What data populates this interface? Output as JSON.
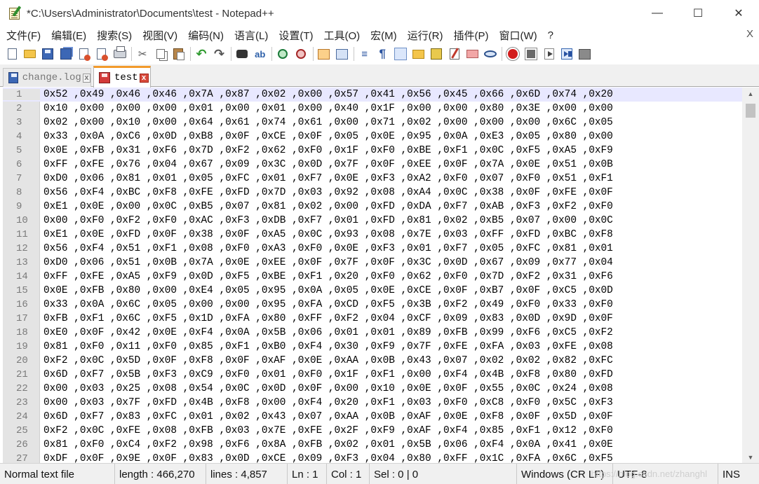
{
  "window": {
    "title": "*C:\\Users\\Administrator\\Documents\\test - Notepad++",
    "minimize": "—",
    "maximize": "☐",
    "close": "✕"
  },
  "menu": {
    "items": [
      "文件(F)",
      "编辑(E)",
      "搜索(S)",
      "视图(V)",
      "编码(N)",
      "语言(L)",
      "设置(T)",
      "工具(O)",
      "宏(M)",
      "运行(R)",
      "插件(P)",
      "窗口(W)",
      "?"
    ],
    "close_doc": "X"
  },
  "toolbar": {
    "icons": [
      "new-file-icon",
      "open-file-icon",
      "save-icon",
      "save-all-icon",
      "close-file-icon",
      "close-all-icon",
      "print-icon",
      "cut-icon",
      "copy-icon",
      "paste-icon",
      "undo-icon",
      "redo-icon",
      "find-icon",
      "replace-icon",
      "zoom-in-icon",
      "zoom-out-icon",
      "sync-vertical-icon",
      "sync-horizontal-icon",
      "word-wrap-icon",
      "show-all-chars-icon",
      "indent-guide-icon",
      "fold-icon",
      "document-map-icon",
      "function-list-icon",
      "folder-workspace-icon",
      "monitoring-icon",
      "record-macro-icon",
      "stop-record-icon",
      "play-macro-icon",
      "run-macro-multiple-icon",
      "save-macro-icon"
    ]
  },
  "tabs": [
    {
      "label": "change.log",
      "active": false,
      "close": "x"
    },
    {
      "label": "test",
      "active": true,
      "close": "x"
    }
  ],
  "editor": {
    "lines": [
      {
        "no": "1",
        "text": "0x52 ,0x49 ,0x46 ,0x46 ,0x7A ,0x87 ,0x02 ,0x00 ,0x57 ,0x41 ,0x56 ,0x45 ,0x66 ,0x6D ,0x74 ,0x20"
      },
      {
        "no": "2",
        "text": "0x10 ,0x00 ,0x00 ,0x00 ,0x01 ,0x00 ,0x01 ,0x00 ,0x40 ,0x1F ,0x00 ,0x00 ,0x80 ,0x3E ,0x00 ,0x00"
      },
      {
        "no": "3",
        "text": "0x02 ,0x00 ,0x10 ,0x00 ,0x64 ,0x61 ,0x74 ,0x61 ,0x00 ,0x71 ,0x02 ,0x00 ,0x00 ,0x00 ,0x6C ,0x05"
      },
      {
        "no": "4",
        "text": "0x33 ,0x0A ,0xC6 ,0x0D ,0xB8 ,0x0F ,0xCE ,0x0F ,0x05 ,0x0E ,0x95 ,0x0A ,0xE3 ,0x05 ,0x80 ,0x00"
      },
      {
        "no": "5",
        "text": "0x0E ,0xFB ,0x31 ,0xF6 ,0x7D ,0xF2 ,0x62 ,0xF0 ,0x1F ,0xF0 ,0xBE ,0xF1 ,0x0C ,0xF5 ,0xA5 ,0xF9"
      },
      {
        "no": "6",
        "text": "0xFF ,0xFE ,0x76 ,0x04 ,0x67 ,0x09 ,0x3C ,0x0D ,0x7F ,0x0F ,0xEE ,0x0F ,0x7A ,0x0E ,0x51 ,0x0B"
      },
      {
        "no": "7",
        "text": "0xD0 ,0x06 ,0x81 ,0x01 ,0x05 ,0xFC ,0x01 ,0xF7 ,0x0E ,0xF3 ,0xA2 ,0xF0 ,0x07 ,0xF0 ,0x51 ,0xF1"
      },
      {
        "no": "8",
        "text": "0x56 ,0xF4 ,0xBC ,0xF8 ,0xFE ,0xFD ,0x7D ,0x03 ,0x92 ,0x08 ,0xA4 ,0x0C ,0x38 ,0x0F ,0xFE ,0x0F"
      },
      {
        "no": "9",
        "text": "0xE1 ,0x0E ,0x00 ,0x0C ,0xB5 ,0x07 ,0x81 ,0x02 ,0x00 ,0xFD ,0xDA ,0xF7 ,0xAB ,0xF3 ,0xF2 ,0xF0"
      },
      {
        "no": "10",
        "text": "0x00 ,0xF0 ,0xF2 ,0xF0 ,0xAC ,0xF3 ,0xDB ,0xF7 ,0x01 ,0xFD ,0x81 ,0x02 ,0xB5 ,0x07 ,0x00 ,0x0C"
      },
      {
        "no": "11",
        "text": "0xE1 ,0x0E ,0xFD ,0x0F ,0x38 ,0x0F ,0xA5 ,0x0C ,0x93 ,0x08 ,0x7E ,0x03 ,0xFF ,0xFD ,0xBC ,0xF8"
      },
      {
        "no": "12",
        "text": "0x56 ,0xF4 ,0x51 ,0xF1 ,0x08 ,0xF0 ,0xA3 ,0xF0 ,0x0E ,0xF3 ,0x01 ,0xF7 ,0x05 ,0xFC ,0x81 ,0x01"
      },
      {
        "no": "13",
        "text": "0xD0 ,0x06 ,0x51 ,0x0B ,0x7A ,0x0E ,0xEE ,0x0F ,0x7F ,0x0F ,0x3C ,0x0D ,0x67 ,0x09 ,0x77 ,0x04"
      },
      {
        "no": "14",
        "text": "0xFF ,0xFE ,0xA5 ,0xF9 ,0x0D ,0xF5 ,0xBE ,0xF1 ,0x20 ,0xF0 ,0x62 ,0xF0 ,0x7D ,0xF2 ,0x31 ,0xF6"
      },
      {
        "no": "15",
        "text": "0x0E ,0xFB ,0x80 ,0x00 ,0xE4 ,0x05 ,0x95 ,0x0A ,0x05 ,0x0E ,0xCE ,0x0F ,0xB7 ,0x0F ,0xC5 ,0x0D"
      },
      {
        "no": "16",
        "text": "0x33 ,0x0A ,0x6C ,0x05 ,0x00 ,0x00 ,0x95 ,0xFA ,0xCD ,0xF5 ,0x3B ,0xF2 ,0x49 ,0xF0 ,0x33 ,0xF0"
      },
      {
        "no": "17",
        "text": "0xFB ,0xF1 ,0x6C ,0xF5 ,0x1D ,0xFA ,0x80 ,0xFF ,0xF2 ,0x04 ,0xCF ,0x09 ,0x83 ,0x0D ,0x9D ,0x0F"
      },
      {
        "no": "18",
        "text": "0xE0 ,0x0F ,0x42 ,0x0E ,0xF4 ,0x0A ,0x5B ,0x06 ,0x01 ,0x01 ,0x89 ,0xFB ,0x99 ,0xF6 ,0xC5 ,0xF2"
      },
      {
        "no": "19",
        "text": "0x81 ,0xF0 ,0x11 ,0xF0 ,0x85 ,0xF1 ,0xB0 ,0xF4 ,0x30 ,0xF9 ,0x7F ,0xFE ,0xFA ,0x03 ,0xFE ,0x08"
      },
      {
        "no": "20",
        "text": "0xF2 ,0x0C ,0x5D ,0x0F ,0xF8 ,0x0F ,0xAF ,0x0E ,0xAA ,0x0B ,0x43 ,0x07 ,0x02 ,0x02 ,0x82 ,0xFC"
      },
      {
        "no": "21",
        "text": "0x6D ,0xF7 ,0x5B ,0xF3 ,0xC9 ,0xF0 ,0x01 ,0xF0 ,0x1F ,0xF1 ,0x00 ,0xF4 ,0x4B ,0xF8 ,0x80 ,0xFD"
      },
      {
        "no": "22",
        "text": "0x00 ,0x03 ,0x25 ,0x08 ,0x54 ,0x0C ,0x0D ,0x0F ,0x00 ,0x10 ,0x0E ,0x0F ,0x55 ,0x0C ,0x24 ,0x08"
      },
      {
        "no": "23",
        "text": "0x00 ,0x03 ,0x7F ,0xFD ,0x4B ,0xF8 ,0x00 ,0xF4 ,0x20 ,0xF1 ,0x03 ,0xF0 ,0xC8 ,0xF0 ,0x5C ,0xF3"
      },
      {
        "no": "24",
        "text": "0x6D ,0xF7 ,0x83 ,0xFC ,0x01 ,0x02 ,0x43 ,0x07 ,0xAA ,0x0B ,0xAF ,0x0E ,0xF8 ,0x0F ,0x5D ,0x0F"
      },
      {
        "no": "25",
        "text": "0xF2 ,0x0C ,0xFE ,0x08 ,0xFB ,0x03 ,0x7E ,0xFE ,0x2F ,0xF9 ,0xAF ,0xF4 ,0x85 ,0xF1 ,0x12 ,0xF0"
      },
      {
        "no": "26",
        "text": "0x81 ,0xF0 ,0xC4 ,0xF2 ,0x98 ,0xF6 ,0x8A ,0xFB ,0x02 ,0x01 ,0x5B ,0x06 ,0xF4 ,0x0A ,0x41 ,0x0E"
      },
      {
        "no": "27",
        "text": "0xDF ,0x0F ,0x9E ,0x0F ,0x83 ,0x0D ,0xCE ,0x09 ,0xF3 ,0x04 ,0x80 ,0xFF ,0x1C ,0xFA ,0x6C ,0xF5"
      }
    ]
  },
  "scrollbar": {
    "up": "▲",
    "down": "▼"
  },
  "status": {
    "type": "Normal text file",
    "length": "length : 466,270",
    "lines": "lines : 4,857",
    "ln": "Ln : 1",
    "col": "Col : 1",
    "sel": "Sel : 0 | 0",
    "eol": "Windows (CR LF)",
    "encoding": "UTF-8",
    "mode": "INS",
    "watermark": "https://blog.csdn.net/zhanghl"
  }
}
